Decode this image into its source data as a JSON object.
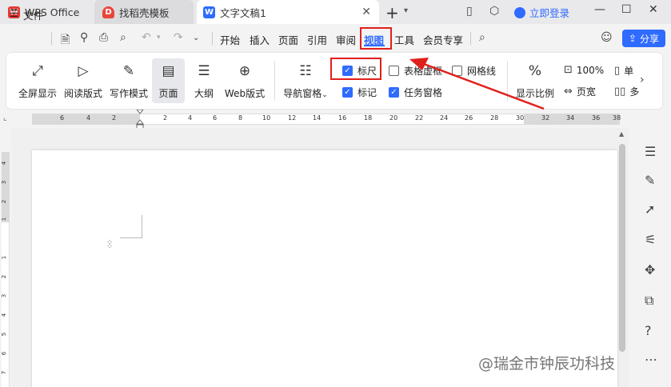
{
  "tabs": [
    {
      "label": "WPS Office",
      "icon": "wps-logo-icon"
    },
    {
      "label": "找稻壳模板",
      "icon": "docer-icon"
    },
    {
      "label": "文字文稿1",
      "icon": "word-doc-icon"
    }
  ],
  "account": {
    "login_label": "立即登录"
  },
  "menu": {
    "file": "文件",
    "items": [
      "开始",
      "插入",
      "页面",
      "引用",
      "审阅",
      "视图",
      "工具",
      "会员专享"
    ],
    "share": "分享"
  },
  "ribbon": {
    "buttons": [
      "全屏显示",
      "阅读版式",
      "写作模式",
      "页面",
      "大纲",
      "Web版式"
    ],
    "nav_pane": "导航窗格",
    "checks": [
      {
        "label": "标尺",
        "checked": true
      },
      {
        "label": "表格虚框",
        "checked": false
      },
      {
        "label": "网格线",
        "checked": false
      },
      {
        "label": "标记",
        "checked": true
      },
      {
        "label": "任务窗格",
        "checked": true
      }
    ],
    "zoom_label": "显示比例",
    "zoom_100": "100%",
    "page_width": "页宽",
    "single_page": "单",
    "multi_page": "多"
  },
  "ruler": {
    "h_ticks": [
      "6",
      "4",
      "2",
      "2",
      "4",
      "6",
      "8",
      "10",
      "12",
      "14",
      "16",
      "18",
      "20",
      "22",
      "24",
      "26",
      "28",
      "30",
      "32",
      "34",
      "36",
      "38"
    ],
    "v_ticks": [
      "4",
      "3",
      "2",
      "1",
      "1",
      "2",
      "3",
      "4",
      "5",
      "6",
      "7"
    ]
  },
  "watermark": "@瑞金市钟辰功科技",
  "colors": {
    "accent": "#2f6bff",
    "highlight": "#e0201b"
  }
}
